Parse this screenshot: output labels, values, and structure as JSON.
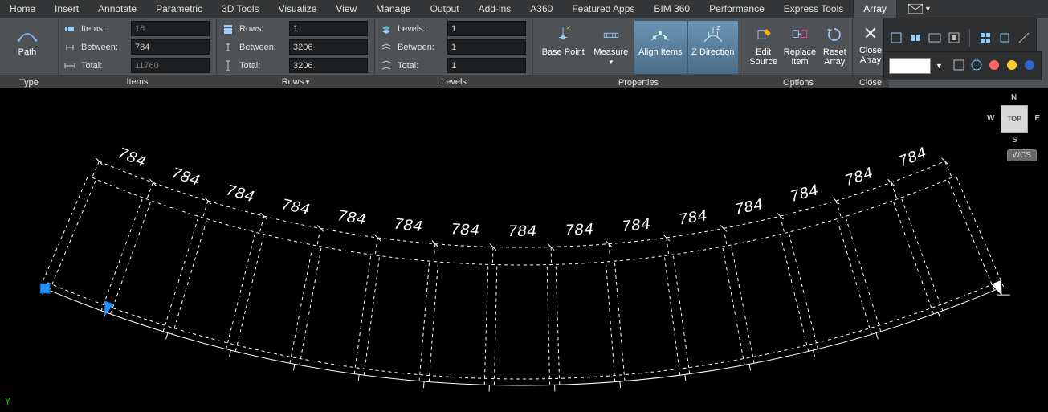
{
  "tabs": [
    "Home",
    "Insert",
    "Annotate",
    "Parametric",
    "3D Tools",
    "Visualize",
    "View",
    "Manage",
    "Output",
    "Add-ins",
    "A360",
    "Featured Apps",
    "BIM 360",
    "Performance",
    "Express Tools",
    "Array"
  ],
  "active_tab": "Array",
  "panels": {
    "type": {
      "title": "Type",
      "button": "Path"
    },
    "items": {
      "title": "Items",
      "items_label": "Items:",
      "items_val": "16",
      "items_disabled": true,
      "between_label": "Between:",
      "between_val": "784",
      "total_label": "Total:",
      "total_val": "11760",
      "total_disabled": true
    },
    "rows": {
      "title": "Rows",
      "rows_label": "Rows:",
      "rows_val": "1",
      "between_label": "Between:",
      "between_val": "3206",
      "total_label": "Total:",
      "total_val": "3206"
    },
    "levels": {
      "title": "Levels",
      "levels_label": "Levels:",
      "levels_val": "1",
      "between_label": "Between:",
      "between_val": "1",
      "total_label": "Total:",
      "total_val": "1"
    },
    "properties": {
      "title": "Properties",
      "base": "Base Point",
      "measure": "Measure",
      "align": "Align Items",
      "zdir": "Z Direction"
    },
    "options": {
      "title": "Options",
      "edit": "Edit\nSource",
      "replace": "Replace\nItem",
      "reset": "Reset\nArray"
    },
    "close": {
      "title": "Close",
      "close": "Close\nArray"
    }
  },
  "viewcube": {
    "top": "TOP",
    "n": "N",
    "s": "S",
    "e": "E",
    "w": "W",
    "wcs": "WCS"
  },
  "ucs": "Y",
  "drawing": {
    "dim_value": "784",
    "count": 16
  }
}
